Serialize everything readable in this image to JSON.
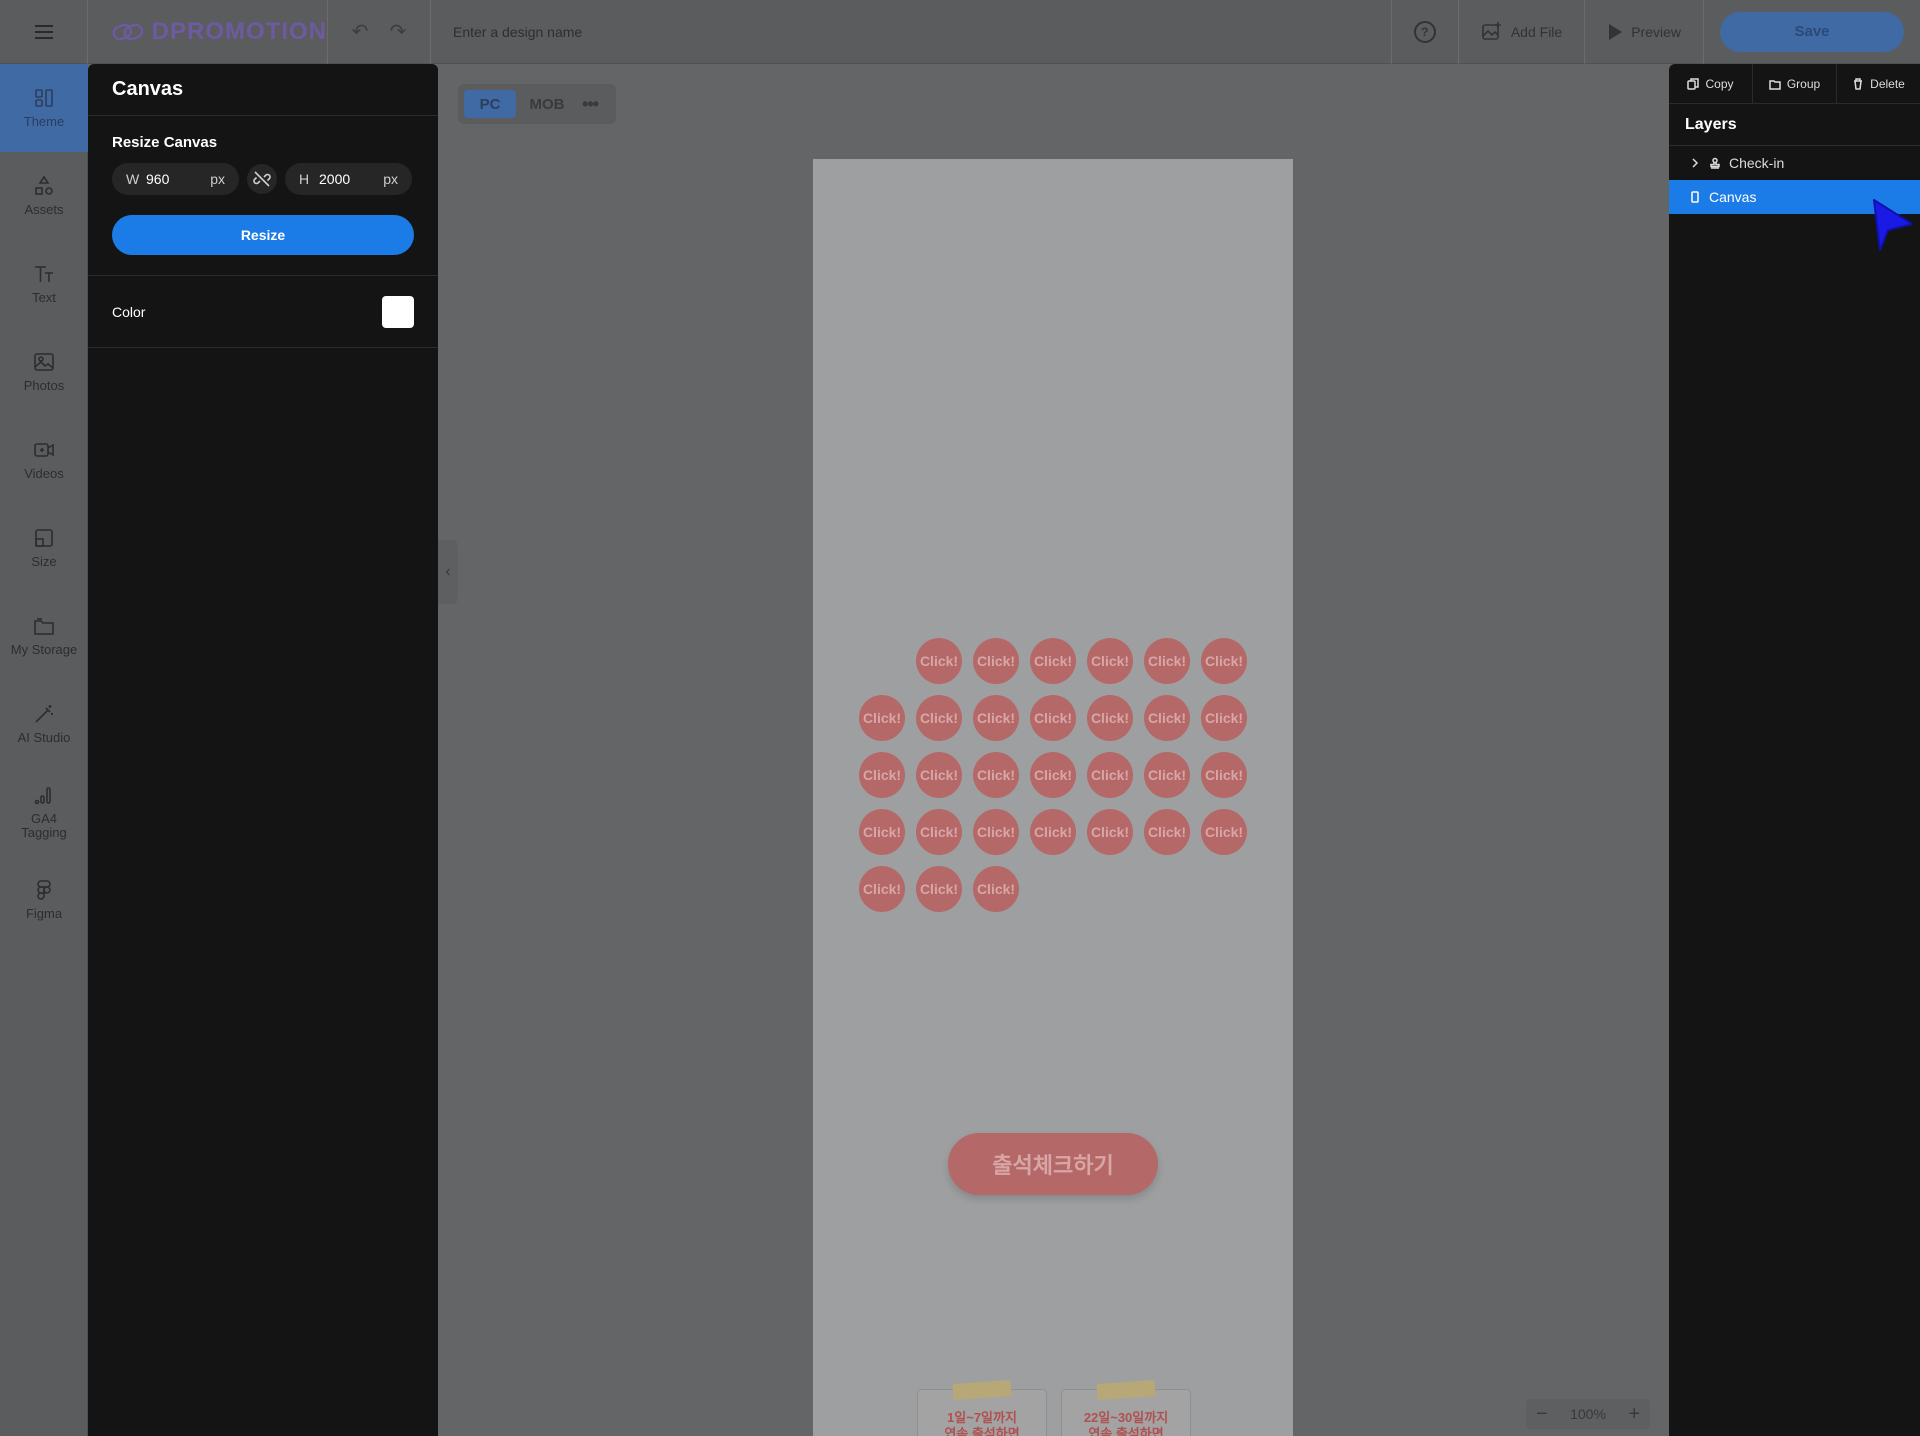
{
  "app": {
    "logo_text": "DPROMOTION",
    "design_name_placeholder": "Enter a design name",
    "help_label": "?",
    "add_file_label": "Add File",
    "preview_label": "Preview",
    "save_label": "Save"
  },
  "rail": {
    "items": [
      {
        "label": "Theme",
        "icon": "theme-icon"
      },
      {
        "label": "Assets",
        "icon": "assets-icon"
      },
      {
        "label": "Text",
        "icon": "text-icon"
      },
      {
        "label": "Photos",
        "icon": "photos-icon"
      },
      {
        "label": "Videos",
        "icon": "videos-icon"
      },
      {
        "label": "Size",
        "icon": "size-icon"
      },
      {
        "label": "My Storage",
        "icon": "folder-icon"
      },
      {
        "label": "AI Studio",
        "icon": "magic-wand-icon"
      },
      {
        "label": "GA4",
        "label2": "Tagging",
        "icon": "bar-chart-icon"
      },
      {
        "label": "Figma",
        "icon": "figma-icon"
      }
    ]
  },
  "panel": {
    "title": "Canvas",
    "resize_title": "Resize Canvas",
    "width_key": "W",
    "width_value": "960",
    "height_key": "H",
    "height_value": "2000",
    "unit": "px",
    "resize_label": "Resize",
    "color_label": "Color",
    "color_value": "#ffffff"
  },
  "workspace": {
    "pc_label": "PC",
    "mob_label": "MOB",
    "more_label": "•••",
    "click_label": "Click!",
    "checkin_button": "출석체크하기",
    "promo_left": "1일~7일까지",
    "promo_left_2": "연속 출석하면",
    "promo_right": "22일~30일까지",
    "promo_right_2": "연속 출석하면",
    "zoom_level": "100%"
  },
  "right_panel": {
    "copy_label": "Copy",
    "group_label": "Group",
    "delete_label": "Delete",
    "layers_title": "Layers",
    "layers": [
      {
        "label": "Check-in",
        "selected": false
      },
      {
        "label": "Canvas",
        "selected": true
      }
    ]
  },
  "colors": {
    "accent": "#1b7ce7",
    "overlay_dim": "#646567",
    "click_circle": "#b56868"
  }
}
